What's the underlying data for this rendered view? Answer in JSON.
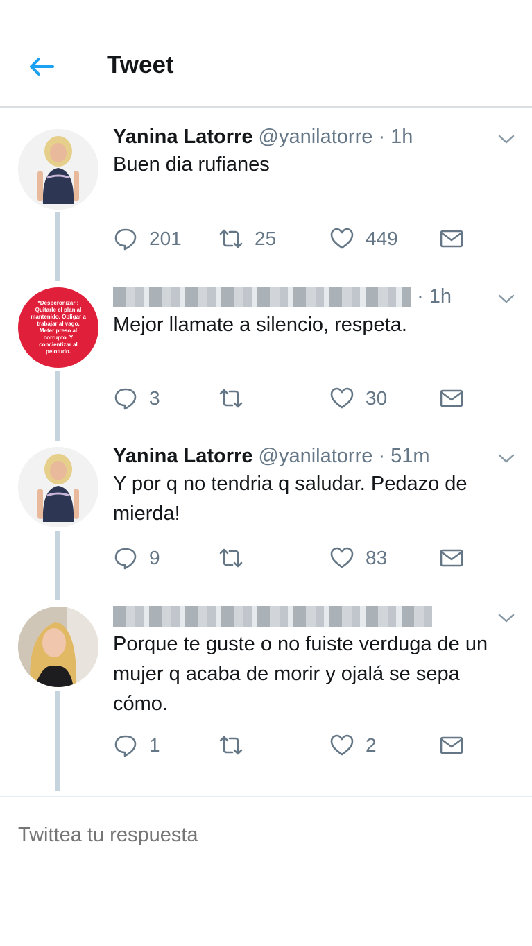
{
  "header": {
    "title": "Tweet",
    "back_icon": "arrow-left-icon"
  },
  "tweets": [
    {
      "name": "Yanina Latorre",
      "handle": "@yanilatorre",
      "time": "1h",
      "text": "Buen dia rufianes",
      "replies": "201",
      "retweets": "25",
      "likes": "449",
      "avatar": "woman-blonde-photo"
    },
    {
      "name": "",
      "handle": "",
      "time": "1h",
      "text": "Mejor llamate a silencio, respeta.",
      "replies": "3",
      "retweets": "",
      "likes": "30",
      "avatar_text": "*Desperonizar : Quitarle el plan al mantenido. Obligar a trabajar al vago. Meter preso al corrupto. Y concientizar al pelotudo."
    },
    {
      "name": "Yanina Latorre",
      "handle": "@yanilatorre",
      "time": "51m",
      "text": "Y por q no tendria q saludar. Pedazo de mierda!",
      "replies": "9",
      "retweets": "",
      "likes": "83",
      "avatar": "woman-blonde-photo"
    },
    {
      "name": "",
      "handle": "",
      "time": "",
      "text": "Porque te guste o no fuiste verduga de un mujer q acaba de morir y ojalá se sepa cómo.",
      "replies": "1",
      "retweets": "",
      "likes": "2",
      "avatar": "woman-blonde-selfie"
    }
  ],
  "reply_box": {
    "placeholder": "Twittea tu respuesta"
  },
  "colors": {
    "accent": "#1da1f2",
    "muted": "#657786",
    "avatar_red": "#e0203a"
  }
}
